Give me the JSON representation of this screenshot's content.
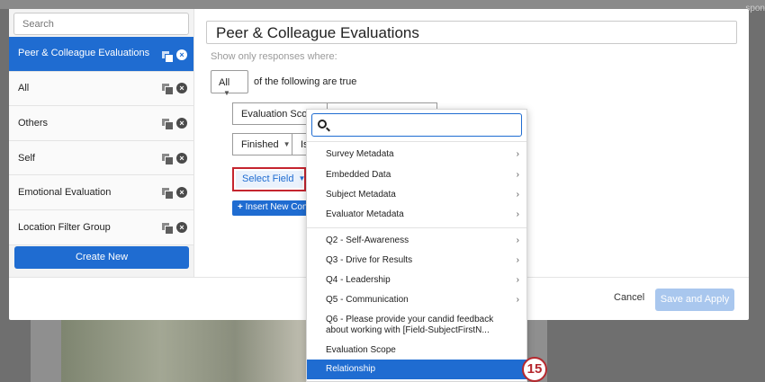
{
  "background": {
    "partial_label": "spon"
  },
  "left_pane": {
    "search_placeholder": "Search",
    "filters": [
      {
        "label": "Peer & Colleague Evaluations",
        "active": true
      },
      {
        "label": "All"
      },
      {
        "label": "Others"
      },
      {
        "label": "Self"
      },
      {
        "label": "Emotional Evaluation"
      },
      {
        "label": "Location Filter Group"
      }
    ],
    "create_label": "Create New"
  },
  "editor": {
    "filter_name": "Peer & Colleague Evaluations",
    "hint": "Show only responses where:",
    "all_label": "All",
    "condition_text": "of the following are true",
    "row1": {
      "field": "Evaluation Scope"
    },
    "row2": {
      "field": "Finished",
      "op": "Is"
    },
    "select_field_label": "Select Field",
    "insert_label": "Insert New Condition"
  },
  "footer": {
    "cancel_label": "Cancel",
    "save_label": "Save and Apply"
  },
  "dropdown": {
    "items": [
      {
        "label": "Survey Metadata",
        "submenu": true
      },
      {
        "label": "Embedded Data",
        "submenu": true
      },
      {
        "label": "Subject Metadata",
        "submenu": true
      },
      {
        "label": "Evaluator Metadata",
        "submenu": true
      },
      {
        "label": "Q2 - Self-Awareness",
        "submenu": true
      },
      {
        "label": "Q3 - Drive for Results",
        "submenu": true
      },
      {
        "label": "Q4 - Leadership",
        "submenu": true
      },
      {
        "label": "Q5 - Communication",
        "submenu": true
      },
      {
        "label": "Q6 - Please provide your candid feedback about working with [Field-SubjectFirstN..."
      },
      {
        "label": "Evaluation Scope"
      },
      {
        "label": "Relationship",
        "selected": true
      }
    ]
  },
  "step_badge": "15",
  "colors": {
    "accent": "#1f6cd1",
    "highlight_border": "#c5252f"
  }
}
